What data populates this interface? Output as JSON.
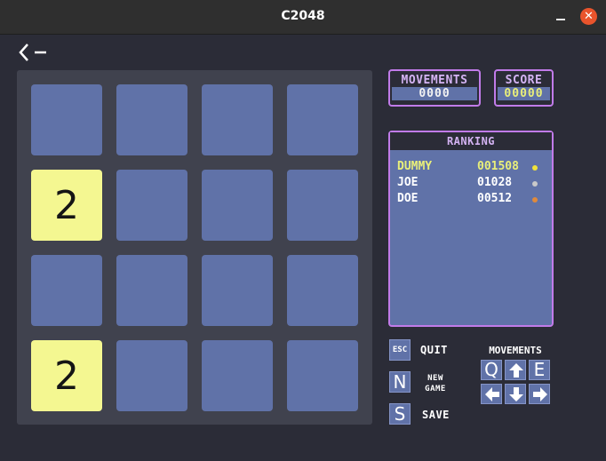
{
  "window": {
    "title": "C2048"
  },
  "title_controls": {
    "close_glyph": "✕"
  },
  "board": {
    "rows": [
      [
        "",
        "",
        "",
        ""
      ],
      [
        "2",
        "",
        "",
        ""
      ],
      [
        "",
        "",
        "",
        ""
      ],
      [
        "2",
        "",
        "",
        ""
      ]
    ]
  },
  "stats": {
    "movements_label": "MOVEMENTS",
    "movements_value": "0000",
    "score_label": "SCORE",
    "score_value": "00000"
  },
  "ranking": {
    "title": "RANKING",
    "entries": [
      {
        "name": "DUMMY",
        "score": "001508",
        "color": "#e9ef7a",
        "medal_color": "#f0e33a"
      },
      {
        "name": "JOE",
        "score": "01028",
        "color": "#ffffff",
        "medal_color": "#c9c9c9"
      },
      {
        "name": "DOE",
        "score": "00512",
        "color": "#ffffff",
        "medal_color": "#e08a3c"
      }
    ]
  },
  "controls": {
    "esc_key": "ESC",
    "quit_label": "QUIT",
    "n_key": "N",
    "new_game_line1": "NEW",
    "new_game_line2": "GAME",
    "s_key": "S",
    "save_label": "SAVE"
  },
  "movement_keys": {
    "title": "MOVEMENTS",
    "q": "Q",
    "e": "E",
    "icons": [
      "arrow-up",
      "arrow-left",
      "arrow-down",
      "arrow-right"
    ]
  },
  "colors": {
    "tile_empty": "#6072a8",
    "tile_2": "#f4f791",
    "accent": "#c17be9",
    "board_bg": "#40424e"
  }
}
